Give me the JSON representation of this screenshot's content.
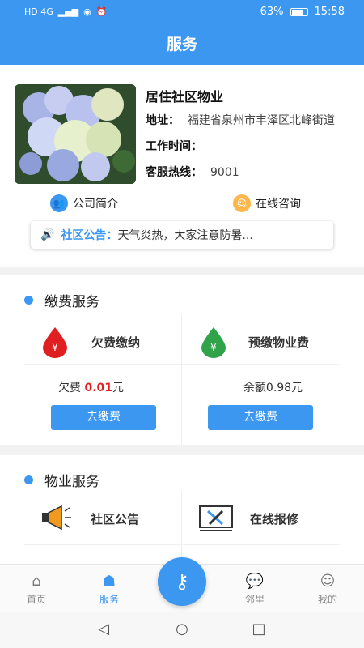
{
  "status_bar": {
    "network": "HD 4G",
    "signal": "▂▄▆",
    "battery": "63%",
    "time": "15:58"
  },
  "header": {
    "title": "服务"
  },
  "property": {
    "name": "居住社区物业",
    "address_label": "地址：",
    "address_value": "福建省泉州市丰泽区北峰街道",
    "hours_label": "工作时间：",
    "hours_value": "",
    "hotline_label": "客服热线：",
    "hotline_value": "9001"
  },
  "links": {
    "intro": "公司简介",
    "consult": "在线咨询"
  },
  "notice": {
    "tag": "社区公告：",
    "text": "天气炎热，大家注意防暑..."
  },
  "payment": {
    "title": "缴费服务",
    "arrears": {
      "label": "欠费缴纳",
      "amount_prefix": "欠费 ",
      "amount": "0.01",
      "amount_suffix": "元",
      "button": "去缴费"
    },
    "prepay": {
      "label": "预缴物业费",
      "amount_text": "余额0.98元",
      "button": "去缴费"
    }
  },
  "services": {
    "title": "物业服务",
    "items": [
      {
        "label": "社区公告",
        "icon": "megaphone-icon"
      },
      {
        "label": "在线报修",
        "icon": "tools-icon"
      }
    ]
  },
  "tabs": [
    {
      "label": "首页",
      "icon": "home-icon"
    },
    {
      "label": "服务",
      "icon": "service-icon"
    },
    {
      "label": "邻里",
      "icon": "chat-icon"
    },
    {
      "label": "我的",
      "icon": "user-icon"
    }
  ],
  "colors": {
    "primary": "#3c97f0",
    "warning": "#e02020",
    "green": "#2fa24a"
  }
}
